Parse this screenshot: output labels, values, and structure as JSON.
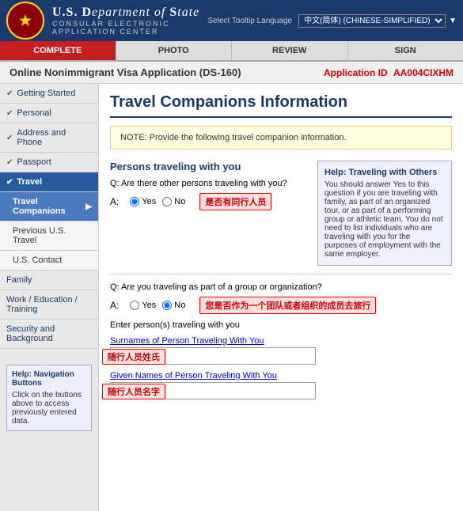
{
  "header": {
    "dept_line1": "U.S. Department",
    "dept_of": "of",
    "dept_state": "State",
    "subtext": "CONSULAR ELECTRONIC APPLICATION CENTER",
    "tooltip_label": "Select Tooltip Language",
    "lang_value": "中文(简体) (CHINESE-SIMPLIFIED)"
  },
  "nav": {
    "items": [
      {
        "label": "COMPLETE",
        "active": true
      },
      {
        "label": "PHOTO",
        "active": false
      },
      {
        "label": "REVIEW",
        "active": false
      },
      {
        "label": "SIGN",
        "active": false
      }
    ]
  },
  "app_header": {
    "title": "Online Nonimmigrant Visa Application (DS-160)",
    "app_id_label": "Application ID",
    "app_id_value": "AA004CIXHM"
  },
  "sidebar": {
    "items": [
      {
        "label": "Getting Started",
        "checked": true,
        "active": false
      },
      {
        "label": "Personal",
        "checked": true,
        "active": false
      },
      {
        "label": "Address and Phone",
        "checked": true,
        "active": false
      },
      {
        "label": "Passport",
        "checked": true,
        "active": false
      },
      {
        "label": "Travel",
        "checked": false,
        "active": true,
        "expanded": true
      },
      {
        "label": "Travel Companions",
        "sub": false,
        "current": true
      },
      {
        "label": "Previous U.S. Travel",
        "sub": true
      },
      {
        "label": "U.S. Contact",
        "sub": true
      },
      {
        "label": "Family",
        "checked": false,
        "active": false
      },
      {
        "label": "Work / Education / Training",
        "checked": false,
        "active": false
      },
      {
        "label": "Security and Background",
        "checked": false,
        "active": false
      }
    ],
    "help": {
      "title": "Help: Navigation Buttons",
      "text": "Click on the buttons above to access previously entered data."
    }
  },
  "content": {
    "page_title": "Travel Companions Information",
    "note": "NOTE: Provide the following travel companion information.",
    "section1": {
      "title": "Persons traveling with you",
      "q1": {
        "q": "Q: Are there other persons traveling with you?",
        "a_label": "A:",
        "annotation": "是否有同行人员"
      },
      "help": {
        "title": "Help: Traveling with Others",
        "text": "You should answer Yes to this question if you are traveling with family, as part of an organized tour, or as part of a performing group or athletic team. You do not need to list individuals who are traveling with you for the purposes of employment with the same employer."
      }
    },
    "q2": {
      "q": "Q: Are you traveling as part of a group or organization?",
      "a_label": "A:",
      "annotation": "您是否作为一个团队或者组织的成员去旅行"
    },
    "subform": {
      "enter_label": "Enter person(s) traveling with you",
      "surname_label": "Surnames of Person Traveling With You",
      "surname_annotation": "随行人员姓氏",
      "given_label": "Given Names of Person Traveling With You",
      "given_annotation": "随行人员名字"
    }
  },
  "radio_options": {
    "yes": "Yes",
    "no": "No"
  }
}
